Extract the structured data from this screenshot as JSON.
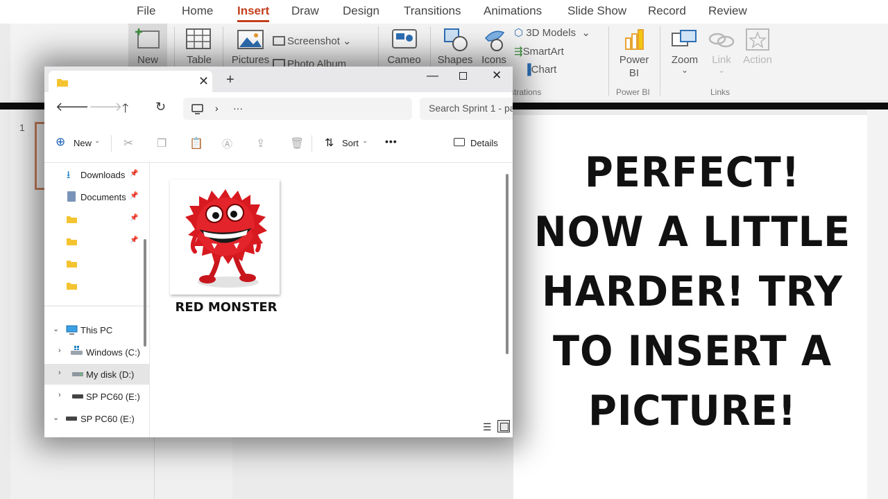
{
  "ppt": {
    "menu_tabs": [
      "File",
      "Home",
      "Insert",
      "Draw",
      "Design",
      "Transitions",
      "Animations",
      "Slide Show",
      "Record",
      "Review"
    ],
    "active_tab": "Insert",
    "ribbon": {
      "new": "New",
      "table": "Table",
      "pictures": "Pictures",
      "screenshot": "Screenshot",
      "photo_album": "Photo Album",
      "cameo": "Cameo",
      "shapes": "Shapes",
      "icons": "Icons",
      "models_3d": "3D Models",
      "smartart": "SmartArt",
      "chart": "Chart",
      "power_bi_1": "Power",
      "power_bi_2": "BI",
      "zoom": "Zoom",
      "link": "Link",
      "action": "Action",
      "group_illustrations": "strations",
      "group_power_bi": "Power BI",
      "group_links": "Links"
    },
    "slide_number": "1"
  },
  "overlay": {
    "line1": "PERFECT!",
    "line2": "NOW A LITTLE",
    "line3": "HARDER! TRY",
    "line4": "TO INSERT A",
    "line5": "PICTURE!"
  },
  "explorer": {
    "tab_close": "✕",
    "tab_add": "+",
    "search_placeholder": "Search Sprint 1 - pa",
    "address_more": "···",
    "toolbar": {
      "new_label": "New",
      "sort_label": "Sort",
      "more_label": "•••",
      "details_label": "Details"
    },
    "sidebar": {
      "quick_access": [
        {
          "label": "Downloads",
          "icon": "download-icon",
          "pinned": true
        },
        {
          "label": "Documents",
          "icon": "documents-icon",
          "pinned": true
        },
        {
          "label": "",
          "icon": "folder-icon",
          "pinned": true
        },
        {
          "label": "",
          "icon": "folder-icon",
          "pinned": true
        },
        {
          "label": "",
          "icon": "folder-icon",
          "pinned": false
        },
        {
          "label": "",
          "icon": "folder-icon",
          "pinned": false
        }
      ],
      "this_pc": "This PC",
      "drives": [
        {
          "label": "Windows (C:)",
          "icon": "windows-drive-icon"
        },
        {
          "label": "My disk (D:)",
          "icon": "drive-icon",
          "selected": true
        },
        {
          "label": "SP PC60 (E:)",
          "icon": "usb-drive-icon"
        }
      ],
      "root_drive": "SP PC60 (E:)"
    },
    "file": {
      "name": "RED MONSTER",
      "icon": "red-monster-image"
    }
  }
}
